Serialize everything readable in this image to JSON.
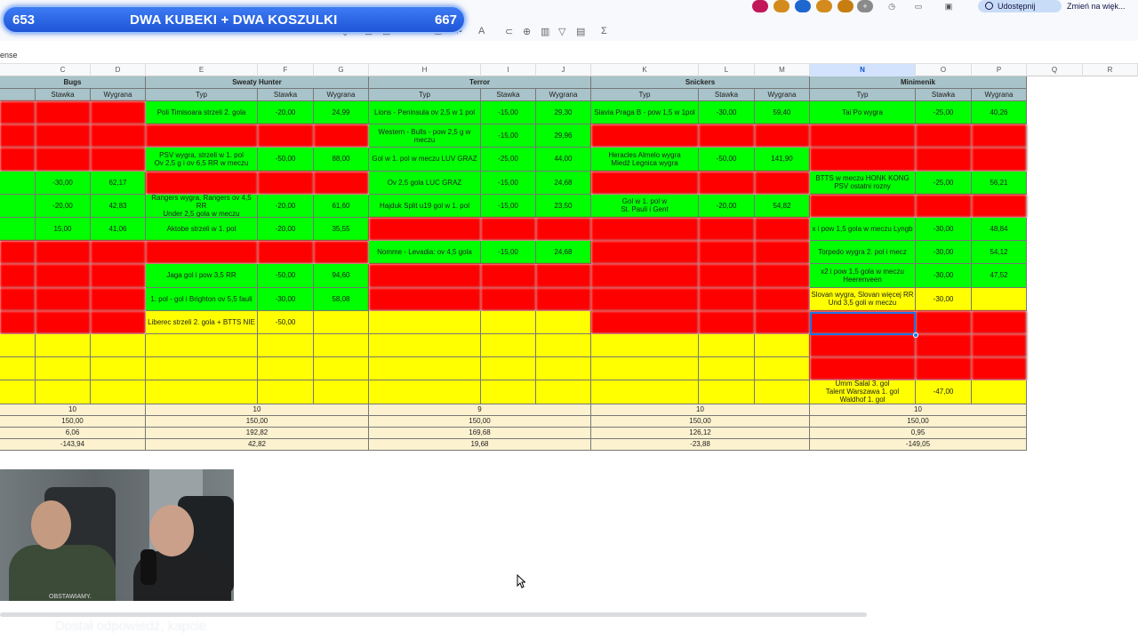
{
  "overlay": {
    "left_count": "653",
    "title": "DWA KUBEKI + DWA KOSZULKI",
    "right_count": "667"
  },
  "topbar": {
    "share_label": "Udostępnij",
    "switch_label": "Zmień na więk..."
  },
  "toolbar": {
    "sigma": "Σ"
  },
  "formula": {
    "text": "ense"
  },
  "columns": [
    "C",
    "D",
    "E",
    "F",
    "G",
    "H",
    "I",
    "J",
    "K",
    "L",
    "M",
    "N",
    "O",
    "P",
    "Q",
    "R"
  ],
  "selected_column": "N",
  "players": [
    "Bugs",
    "Sweaty Hunter",
    "Terror",
    "Snickers",
    "Minimenik"
  ],
  "subheaders": {
    "typ": "Typ",
    "stawka": "Stawka",
    "wygrana": "Wygrana"
  },
  "bugs_rows": [
    [
      "r",
      "r",
      "r"
    ],
    [
      "r",
      "r",
      "r"
    ],
    [
      "r",
      "r",
      "r"
    ],
    [
      "g",
      "-30,00",
      "62,17"
    ],
    [
      "g",
      "-20,00",
      "42,83"
    ],
    [
      "g",
      "15,00",
      "41,06"
    ],
    [
      "r",
      "r",
      "r"
    ],
    [
      "r",
      "r",
      "r"
    ],
    [
      "r",
      "r",
      "r"
    ],
    [
      "r",
      "r",
      "r"
    ]
  ],
  "sweaty_rows": [
    [
      "g",
      "Poli Timisoara strzeli 2. gola",
      "-20,00",
      "24,99"
    ],
    [
      "r",
      "",
      "",
      ""
    ],
    [
      "g",
      "PSV wygra, strzeli w 1. pol\nOv 2,5 g i ov 6,5 RR w meczu",
      "-50,00",
      "88,00"
    ],
    [
      "r",
      "",
      "",
      ""
    ],
    [
      "g",
      "Rangers wygra, Rangers ov 4,5 RR\nUnder 2,5 gola w meczu",
      "-20,00",
      "61,60"
    ],
    [
      "g",
      "Aktobe strzeli w 1. pol",
      "-20,00",
      "35,55"
    ],
    [
      "r",
      "",
      "",
      ""
    ],
    [
      "g",
      "Jaga gol i pow 3,5 RR",
      "-50,00",
      "94,60"
    ],
    [
      "g",
      "1. pol - gol i Brighton ov 5,5 fauli",
      "-30,00",
      "58,08"
    ],
    [
      "y",
      "Liberec strzeli 2. gola + BTTS NIE",
      "-50,00",
      ""
    ]
  ],
  "terror_rows": [
    [
      "g",
      "Lions - Peninsula ov 2,5 w 1 pol",
      "-15,00",
      "29,30"
    ],
    [
      "g",
      "Western - Bulls - pow 2,5 g w meczu",
      "-15,00",
      "29,96"
    ],
    [
      "g",
      "Gol w 1. pol w meczu LUV GRAZ",
      "-25,00",
      "44,00"
    ],
    [
      "g",
      "Ov 2,5 gola LUC GRAZ",
      "-15,00",
      "24,68"
    ],
    [
      "g",
      "Hajduk Split u19 gol w 1. pol",
      "-15,00",
      "23,50"
    ],
    [
      "r",
      "",
      "",
      ""
    ],
    [
      "g",
      "Nomme - Levadia: ov 4,5 gola",
      "-15,00",
      "24,68"
    ],
    [
      "r",
      "",
      "",
      ""
    ],
    [
      "r",
      "",
      "",
      ""
    ]
  ],
  "snickers_rows": [
    [
      "g",
      "Slavia Praga B - pow 1,5 w 1pol",
      "-30,00",
      "59,40"
    ],
    [
      "r",
      "",
      "",
      ""
    ],
    [
      "g",
      "Heracles Almelo wygra\nMiedź Legnica wygra",
      "-50,00",
      "141,90"
    ],
    [
      "r",
      "",
      "",
      ""
    ],
    [
      "g",
      "Gol w 1. pol w\nSt. Pauli i Gent",
      "-20,00",
      "54,82"
    ],
    [
      "r",
      "",
      "",
      ""
    ],
    [
      "r",
      "",
      "",
      ""
    ],
    [
      "r",
      "",
      "",
      ""
    ],
    [
      "r",
      "",
      "",
      ""
    ],
    [
      "r",
      "",
      "",
      ""
    ]
  ],
  "minimenik_rows": [
    [
      "g",
      "Tai Po wygra",
      "-25,00",
      "40,26"
    ],
    [
      "r",
      "",
      "",
      ""
    ],
    [
      "r",
      "",
      "",
      ""
    ],
    [
      "g",
      "BTTS w meczu HONK KONG\nPSV ostatni rozny",
      "-25,00",
      "56,21"
    ],
    [
      "r",
      "",
      "",
      ""
    ],
    [
      "g",
      "x i pow 1,5 gola w meczu Lyngb",
      "-30,00",
      "48,84"
    ],
    [
      "g",
      "Torpedo wygra 2. pol i mecz",
      "-30,00",
      "54,12"
    ],
    [
      "g",
      "x2 i pow 1,5 gola w meczu\nHeerenveen",
      "-30,00",
      "47,52"
    ],
    [
      "y",
      "Slovan wygra, Slovan więcej RR\nUnd 3,5 goli w meczu",
      "-30,00",
      ""
    ],
    [
      "r",
      "",
      "",
      ""
    ],
    [
      "r",
      "",
      "",
      ""
    ],
    [
      "r",
      "",
      "",
      ""
    ],
    [
      "y",
      "Umm Salal 3. gol\nTalent Warszawa 1. gol\nWaldhof 1. gol",
      "-47,00",
      ""
    ]
  ],
  "footer": {
    "bugs": [
      "10",
      "150,00",
      "6,06",
      "-143,94"
    ],
    "sweaty": [
      "10",
      "150,00",
      "192,82",
      "42,82"
    ],
    "terror": [
      "9",
      "150,00",
      "169,68",
      "19,68"
    ],
    "snickers": [
      "10",
      "150,00",
      "126,12",
      "-23,88"
    ],
    "minimenik": [
      "10",
      "150,00",
      "0,95",
      "-149,05"
    ]
  },
  "webcam": {
    "shirt_text": "OBSTAWIAMY."
  },
  "subtitle": "Dostał odpowiedź, kapcie"
}
